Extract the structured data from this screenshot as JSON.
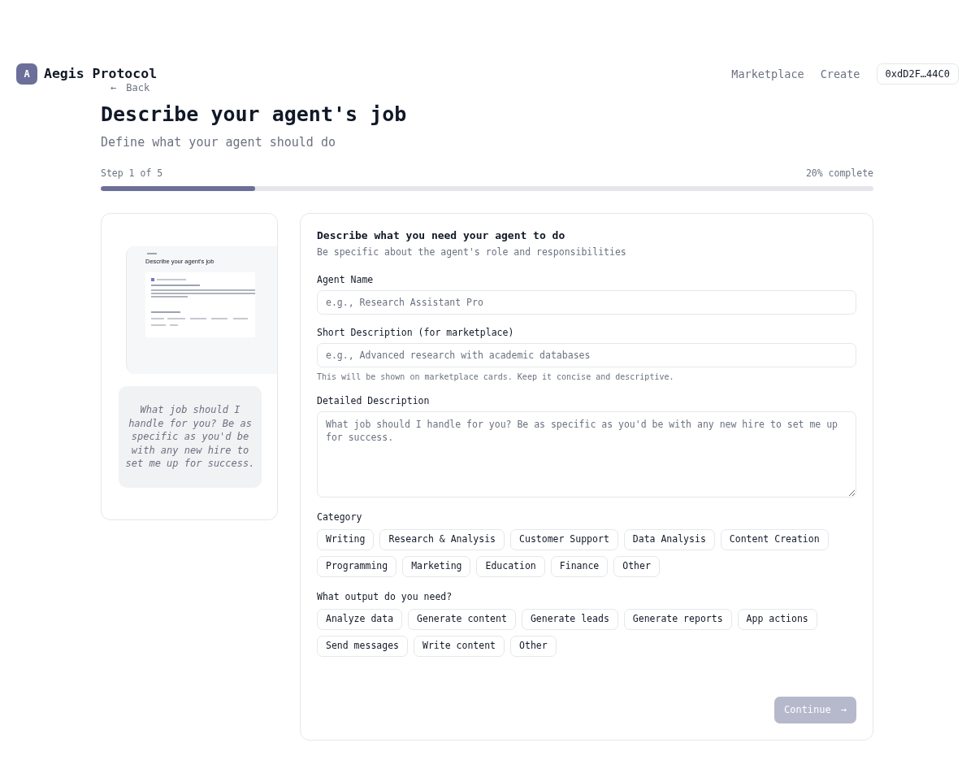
{
  "header": {
    "logo_letter": "A",
    "brand": "Aegis Protocol",
    "nav": [
      "Marketplace",
      "Create"
    ],
    "wallet": "0xdD2F…44C0"
  },
  "back": {
    "arrow": "←",
    "label": "Back"
  },
  "page": {
    "title": "Describe your agent's job",
    "subtitle": "Define what your agent should do"
  },
  "progress": {
    "step": "Step 1 of 5",
    "percent": "20% complete",
    "level": 0.2
  },
  "preview": {
    "mini_title": "Describe your agent's job",
    "quote": "What job should I handle for you? Be as specific as you'd be with any new hire to set me up for success."
  },
  "form": {
    "title": "Describe what you need your agent to do",
    "subtitle": "Be specific about the agent's role and responsibilities",
    "fields": [
      {
        "kind": "input",
        "label": "Agent Name",
        "placeholder": "e.g., Research Assistant Pro"
      },
      {
        "kind": "input",
        "label": "Short Description (for marketplace)",
        "placeholder": "e.g., Advanced research with academic databases",
        "hint": "This will be shown on marketplace cards. Keep it concise and descriptive."
      },
      {
        "kind": "textarea",
        "label": "Detailed Description",
        "placeholder": "What job should I handle for you? Be as specific as you'd be with any new hire to set me up for success."
      }
    ],
    "groups": [
      {
        "label": "Category",
        "chips": [
          {
            "label": "Writing",
            "selected": false
          },
          {
            "label": "Research & Analysis",
            "selected": false
          },
          {
            "label": "Customer Support",
            "selected": false
          },
          {
            "label": "Data Analysis",
            "selected": false
          },
          {
            "label": "Content Creation",
            "selected": false
          },
          {
            "label": "Programming",
            "selected": false
          },
          {
            "label": "Marketing",
            "selected": false
          },
          {
            "label": "Education",
            "selected": false
          },
          {
            "label": "Finance",
            "selected": false
          },
          {
            "label": "Other",
            "selected": false
          }
        ]
      },
      {
        "label": "What output do you need?",
        "chips": [
          {
            "label": "Analyze data",
            "selected": false
          },
          {
            "label": "Generate content",
            "selected": false
          },
          {
            "label": "Generate leads",
            "selected": false
          },
          {
            "label": "Generate reports",
            "selected": false
          },
          {
            "label": "App actions",
            "selected": false
          },
          {
            "label": "Send messages",
            "selected": false
          },
          {
            "label": "Write content",
            "selected": false
          },
          {
            "label": "Other",
            "selected": false
          }
        ]
      }
    ],
    "continue": {
      "label": "Continue",
      "arrow": "→",
      "disabled": true
    }
  }
}
